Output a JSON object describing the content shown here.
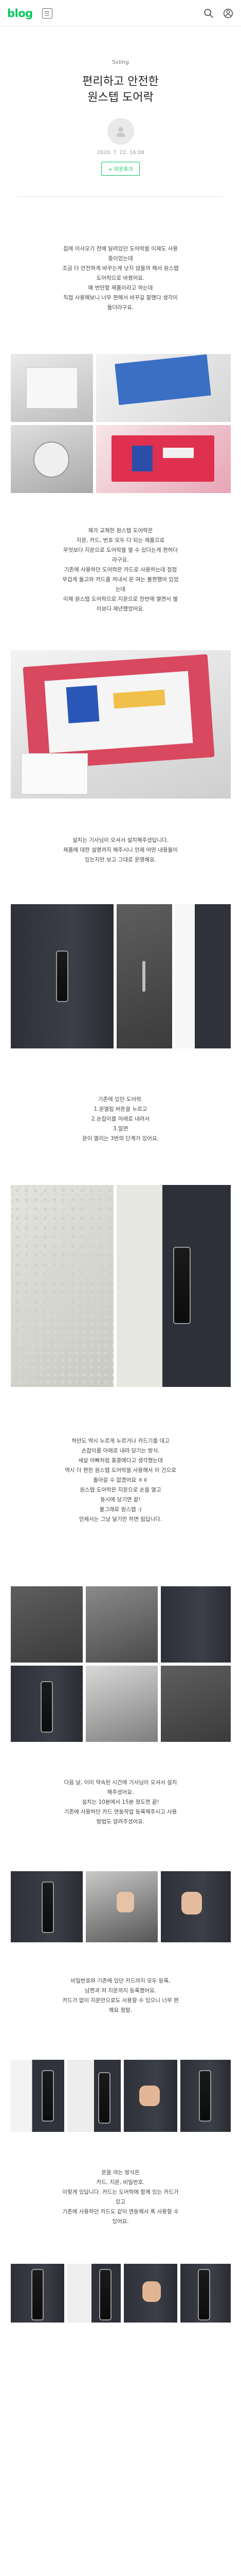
{
  "header": {
    "logo": "blog",
    "menu_icon": "menu-icon",
    "search_icon": "search-icon",
    "more_icon": "more-icon"
  },
  "post": {
    "category": "Ssling",
    "title_line1": "편리하고 안전한",
    "title_line2": "원스텝 도어락",
    "date": "2020. 7. 22. 16:08",
    "neighbor_button": "+ 이웃추가"
  },
  "paragraphs": {
    "p1": [
      "집에 이사오기 전에 달려있던 도어락을 이제도 사용",
      "중이었는데",
      "조금 더 안전하게 바꾸는게 낫지 않을까 해서 원스텝",
      "도어락으로 바꿨어요.",
      "매 번만할 제품이라고 하는데",
      "직접 사용해보니 너무 편해서 바꾸길 잘했다 생각이",
      "들더라구요."
    ],
    "p2": [
      "제가 교체한                원스텝 도어락은",
      "지문, 카드, 번호 모두 다 되는 제품으로",
      "무엇보다 지문으로 도어락을 열 수 있다는게 편하더",
      "라구요.",
      "기존에 사용하던 도어락은 카드로 사용하는데 점점",
      "무겁게 들고와 카드를 꺼내서 문 여는 불편했어 있었",
      "는데",
      "이제 원스텝 도어락으로 지문으로 한번에 열면서 별",
      "이보다 제년했었어요."
    ],
    "p3": [
      "설치는 기사님이 오셔서 설치해주셨답니다.",
      "제품에 대한 설명까지 해주시니 언제 어떤 내용들이",
      "있는지만 보고 그대로 운영해요."
    ],
    "p4": [
      "기존에 있던 도어락.",
      "1.문열림 버튼을 누르고",
      "2.손잡이를 아래로 내려서",
      "3.밀면",
      "문이 열리는 3번의 단계가 있어요."
    ],
    "p5": [
      "하얀도 역시 누르게 누르거나 카드기를 대고",
      "손잡이를 아래로 내려 당기는 방식.",
      "세살 아빠처럼 홍콩에다고 생각했는데",
      "역시 더 편한 원스텝 도어락을 사용해서 이 건으로",
      "돌아갈 수 없겠어요 ㅎㅎ",
      "원스텝 도어락은 지문으로 손을 열고",
      "동시에 당기면 끝!",
      "불그래로 원스텝 :)",
      "언제서는 그냥 달기만 하면 됩답니다."
    ],
    "p6": [
      "다음 날, 이미 약속된 시간에 기사님이 오셔서 설치",
      "해주셨어요.",
      "설치는 10분에서 15분 정도면 끝!",
      "기존에 사용하던 카드 연동작업 등록해주시고 사용",
      "방법도 알려주셨어요."
    ],
    "p7": [
      "비밀번호와 기존에 있던 카드까지 모두 등록,",
      "남편과 저 지문까지 등록했어요.",
      "카드가 없이 지문만으로도 사용할 수 있으니 너무 편",
      "해요 정말."
    ],
    "p8": [
      "문을 여는 방식은",
      "카드, 지문, 비밀번호.",
      "이렇게 있답니다. 카드는 도어락에 함께 있는 카드가",
      "있고",
      "기존에 사용하던 카드도 같이 연동해서 폭 사용할 수",
      "있어요."
    ]
  }
}
